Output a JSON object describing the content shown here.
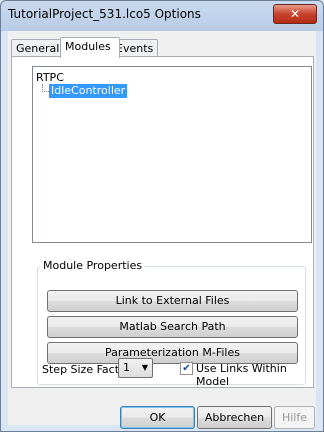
{
  "window": {
    "title": "TutorialProject_531.lco5 Options",
    "close_glyph": "✕"
  },
  "tabs": [
    {
      "label": "General",
      "active": false
    },
    {
      "label": "Modules",
      "active": true
    },
    {
      "label": "Events",
      "active": false
    }
  ],
  "tree": {
    "root": "RTPC",
    "children": [
      {
        "label": "IdleController",
        "selected": true
      }
    ]
  },
  "module_properties": {
    "label": "Module Properties",
    "buttons": [
      "Link to External Files",
      "Matlab Search Path",
      "Parameterization M-Files"
    ],
    "step_size_label": "Step Size Factor",
    "step_size_value": "1",
    "use_links_label": "Use Links Within Model",
    "use_links_checked": true,
    "check_glyph": "✔"
  },
  "footer": {
    "ok": "OK",
    "cancel": "Abbrechen",
    "help": "Hilfe"
  },
  "icons": {
    "close": "close-icon",
    "dropdown": "chevron-down-icon",
    "check": "checkbox-checked-icon"
  },
  "colors": {
    "selection": "#3399ff",
    "close_button": "#c7432c"
  }
}
